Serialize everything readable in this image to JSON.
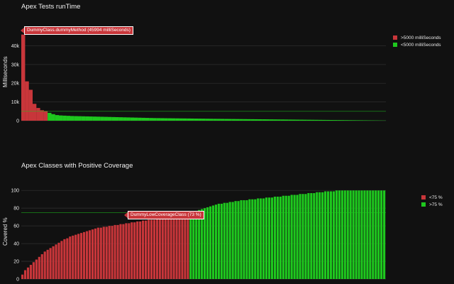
{
  "chart_data": [
    {
      "type": "bar",
      "title": "Apex Tests runTime",
      "xlabel": "",
      "ylabel": "Milliseconds",
      "ylim": [
        0,
        47000
      ],
      "yticks": [
        0,
        10000,
        20000,
        30000,
        40000
      ],
      "ytick_labels": [
        "0",
        "10k",
        "20k",
        "30k",
        "40k"
      ],
      "threshold": 5000,
      "series": [
        {
          "name": ">5000 milliSeconds",
          "color": "#c8363a",
          "values": [
            45994,
            21000,
            16500,
            9000,
            6800,
            5600,
            5200
          ]
        },
        {
          "name": "<5000 milliSeconds",
          "color": "#1ec81e",
          "values": [
            4200,
            3500,
            3000,
            2800,
            2700,
            2600,
            2500,
            2450,
            2400,
            2350,
            2300,
            2250,
            2200,
            2150,
            2100,
            2050,
            2000,
            1950,
            1900,
            1850,
            1800,
            1750,
            1700,
            1650,
            1600,
            1550,
            1500,
            1450,
            1400,
            1380,
            1350,
            1320,
            1300,
            1270,
            1250,
            1220,
            1200,
            1180,
            1150,
            1120,
            1100,
            1080,
            1050,
            1020,
            1000,
            980,
            960,
            940,
            920,
            900,
            880,
            860,
            840,
            820,
            800,
            780,
            760,
            740,
            720,
            700,
            680,
            660,
            640,
            620,
            600,
            580,
            560,
            540,
            520,
            500,
            480,
            460,
            440,
            420,
            400,
            380,
            360,
            340,
            320,
            300,
            280,
            260,
            240,
            220,
            200,
            180,
            160,
            140,
            120,
            100
          ]
        }
      ],
      "annotation": "DummyClass.dummyMethod (45994 milliSeconds)",
      "legend_position": "top-right"
    },
    {
      "type": "bar",
      "title": "Apex Classes with Positive Coverage",
      "xlabel": "",
      "ylabel": "Covered %",
      "ylim": [
        0,
        105
      ],
      "yticks": [
        0,
        20,
        40,
        60,
        80,
        100
      ],
      "ytick_labels": [
        "0",
        "20",
        "40",
        "60",
        "80",
        "100"
      ],
      "threshold": 75,
      "series": [
        {
          "name": "<75 %",
          "color": "#c8363a",
          "values": [
            5,
            10,
            13,
            16,
            19,
            22,
            25,
            28,
            31,
            33,
            35,
            37,
            39,
            41,
            43,
            45,
            46,
            48,
            49,
            50,
            51,
            52,
            53,
            54,
            55,
            56,
            57,
            58,
            58,
            59,
            59,
            60,
            60,
            61,
            61,
            62,
            62,
            63,
            63,
            64,
            64,
            65,
            65,
            66,
            66,
            67,
            67,
            67,
            68,
            68,
            69,
            69,
            70,
            70,
            71,
            71,
            72,
            72,
            73,
            73
          ]
        },
        {
          "name": ">75 %",
          "color": "#1ec81e",
          "values": [
            75,
            76,
            77,
            78,
            79,
            80,
            81,
            82,
            83,
            84,
            85,
            85,
            86,
            86,
            87,
            87,
            88,
            88,
            89,
            89,
            89,
            90,
            90,
            90,
            91,
            91,
            91,
            92,
            92,
            92,
            93,
            93,
            93,
            94,
            94,
            94,
            95,
            95,
            95,
            96,
            96,
            96,
            97,
            97,
            97,
            98,
            98,
            98,
            99,
            99,
            99,
            99,
            100,
            100,
            100,
            100,
            100,
            100,
            100,
            100,
            100,
            100,
            100,
            100,
            100,
            100,
            100,
            100,
            100,
            100
          ]
        }
      ],
      "annotation": "DummyLowCoverageClass (73 %)",
      "legend_position": "top-right"
    }
  ]
}
